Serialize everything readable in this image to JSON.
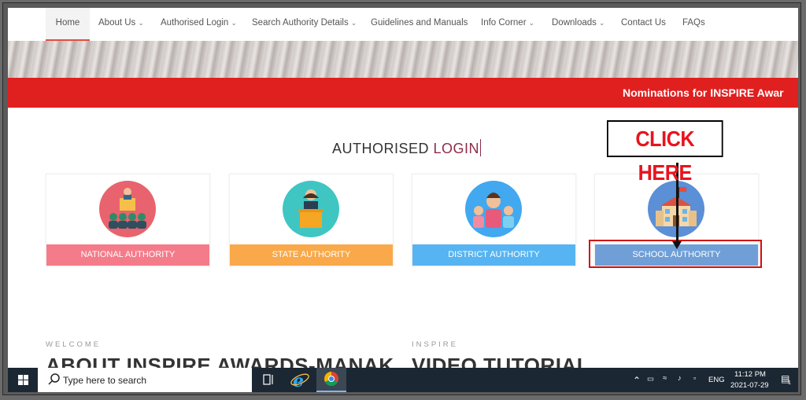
{
  "nav": {
    "items": [
      {
        "label": "Home",
        "dropdown": false,
        "active": true
      },
      {
        "label": "About Us",
        "dropdown": true
      },
      {
        "label": "Authorised Login",
        "dropdown": true
      },
      {
        "label": "Search Authority Details",
        "dropdown": true
      },
      {
        "label": "Guidelines and Manuals",
        "dropdown": false
      },
      {
        "label": "Info Corner",
        "dropdown": true
      },
      {
        "label": "Downloads",
        "dropdown": true
      },
      {
        "label": "Contact Us",
        "dropdown": false
      },
      {
        "label": "FAQs",
        "dropdown": false
      }
    ]
  },
  "marquee": "Nominations for INSPIRE Awar",
  "login": {
    "title_part1": "AUTHORISED ",
    "title_part2": "LOGIN",
    "cards": [
      {
        "label": "NATIONAL AUTHORITY",
        "color": "#f47c8a",
        "icon_bg": "#e8636e",
        "icon": "speaker-audience-icon"
      },
      {
        "label": "STATE AUTHORITY",
        "color": "#f9a94a",
        "icon_bg": "#3fc6c2",
        "icon": "podium-speaker-icon"
      },
      {
        "label": "DISTRICT AUTHORITY",
        "color": "#56b4f2",
        "icon_bg": "#42a8f0",
        "icon": "family-icon"
      },
      {
        "label": "SCHOOL AUTHORITY",
        "color": "#6f9fd6",
        "icon_bg": "#5b8fd6",
        "icon": "school-building-icon"
      }
    ]
  },
  "callout": "CLICK HERE",
  "sections": {
    "welcome_eyebrow": "WELCOME",
    "welcome_title": "ABOUT INSPIRE AWARDS-MANAK",
    "inspire_eyebrow": "INSPIRE",
    "inspire_title": "VIDEO TUTORIAL"
  },
  "taskbar": {
    "search_placeholder": "Type here to search",
    "lang": "ENG",
    "time": "11:12 PM",
    "date": "2021-07-29",
    "notif_count": "1"
  }
}
